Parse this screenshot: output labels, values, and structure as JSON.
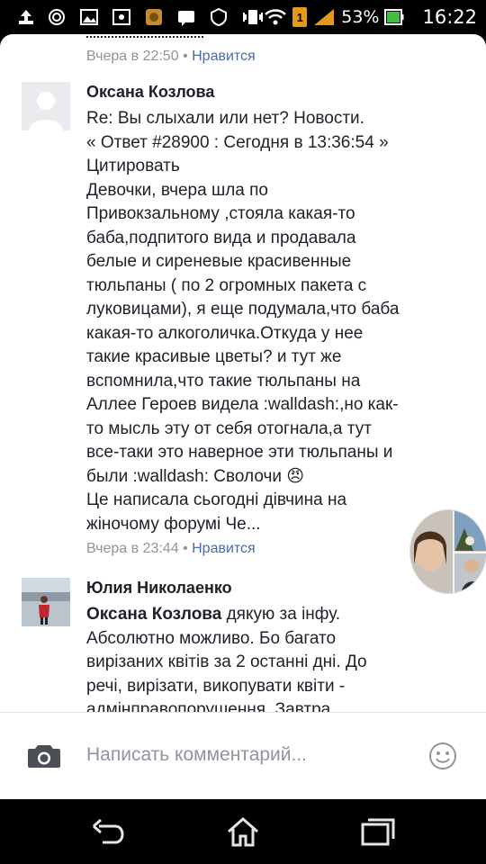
{
  "status_bar": {
    "battery_percent": "53%",
    "time": "16:22",
    "notification_count": "1"
  },
  "comments": [
    {
      "meta_time": "Вчера в 22:50",
      "meta_like": "Нравится"
    },
    {
      "author": "Оксана Козлова",
      "text": "Re: Вы слыхали или нет? Новости.\n« Ответ #28900 : Сегодня в 13:36:54 »\nЦитировать\nДевочки, вчера шла по\nПривокзальному ,стояла какая-то\nбаба,подпитого вида и продавала\nбелые и сиреневые красивенные\nтюльпаны ( по 2 огромных пакета с\nлуковицами),  я еще подумала,что баба\nкакая-то алкоголичка.Откуда у нее\nтакие красивые цветы? и тут же\nвспомнила,что такие тюльпаны на\nАллее Героев видела  :walldash:,но как-\nто мысль эту от себя отогнала,а тут\nвсе-таки это наверное эти тюльпаны и\nбыли :walldash: Сволочи 😠\nЦе написала сьогодні дівчина на\nжіночому форумі Че...",
      "meta_time": "Вчера в 23:44",
      "meta_like": "Нравится"
    },
    {
      "author": "Юлия Николаенко",
      "mention": "Оксана Козлова",
      "text": " дякую за інфу.\nАбсолютно можливо. Бо багато\nвирізаних квітів за 2 останні дні. До\nречі, вирізати, викопувати квіти -\nадмінправопорушення. Завтра"
    }
  ],
  "composer": {
    "placeholder": "Написать комментарий..."
  },
  "icons": {
    "camera": "camera-icon",
    "emoji": "emoji-icon",
    "back": "back-icon",
    "home": "home-icon",
    "recents": "recents-icon"
  },
  "colors": {
    "like_link": "#4b6aa8",
    "meta": "#90949c",
    "text": "#1d2129"
  }
}
